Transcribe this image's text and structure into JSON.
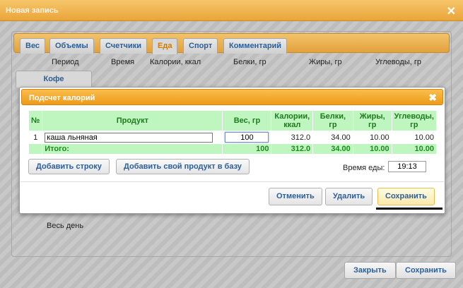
{
  "window": {
    "title": "Новая запись"
  },
  "tabs": [
    {
      "label": "Вес"
    },
    {
      "label": "Объемы"
    },
    {
      "label": "Счетчики"
    },
    {
      "label": "Еда"
    },
    {
      "label": "Спорт"
    },
    {
      "label": "Комментарий"
    }
  ],
  "food_table": {
    "headers": [
      "Период",
      "Время",
      "Калории, ккал",
      "Белки, гр",
      "Жиры, гр",
      "Углеводы, гр"
    ],
    "period_tab": "Кофе",
    "day_label": "Весь день"
  },
  "outer_buttons": {
    "close": "Закрыть",
    "save": "Сохранить"
  },
  "dialog": {
    "title": "Подсчет калорий",
    "columns": [
      "№",
      "Продукт",
      "Вес, гр",
      "Калории, ккал",
      "Белки, гр",
      "Жиры, гр",
      "Углеводы, гр"
    ],
    "rows": [
      {
        "num": "1",
        "product": "каша льняная",
        "weight": "100",
        "calories": "312.0",
        "protein": "34.00",
        "fat": "10.00",
        "carbs": "10.00"
      }
    ],
    "total": {
      "label": "Итого:",
      "weight": "100",
      "calories": "312.0",
      "protein": "34.00",
      "fat": "10.00",
      "carbs": "10.00"
    },
    "add_row": "Добавить строку",
    "add_product": "Добавить свой продукт в базу",
    "meal_time_label": "Время еды:",
    "meal_time": "19:13",
    "cancel": "Отменить",
    "delete": "Удалить",
    "save": "Сохранить"
  },
  "colors": {
    "accent": "#eea32a",
    "header_green": "#bff5bf",
    "link_blue": "#2a5f9a",
    "active_tab": "#d07a00"
  }
}
